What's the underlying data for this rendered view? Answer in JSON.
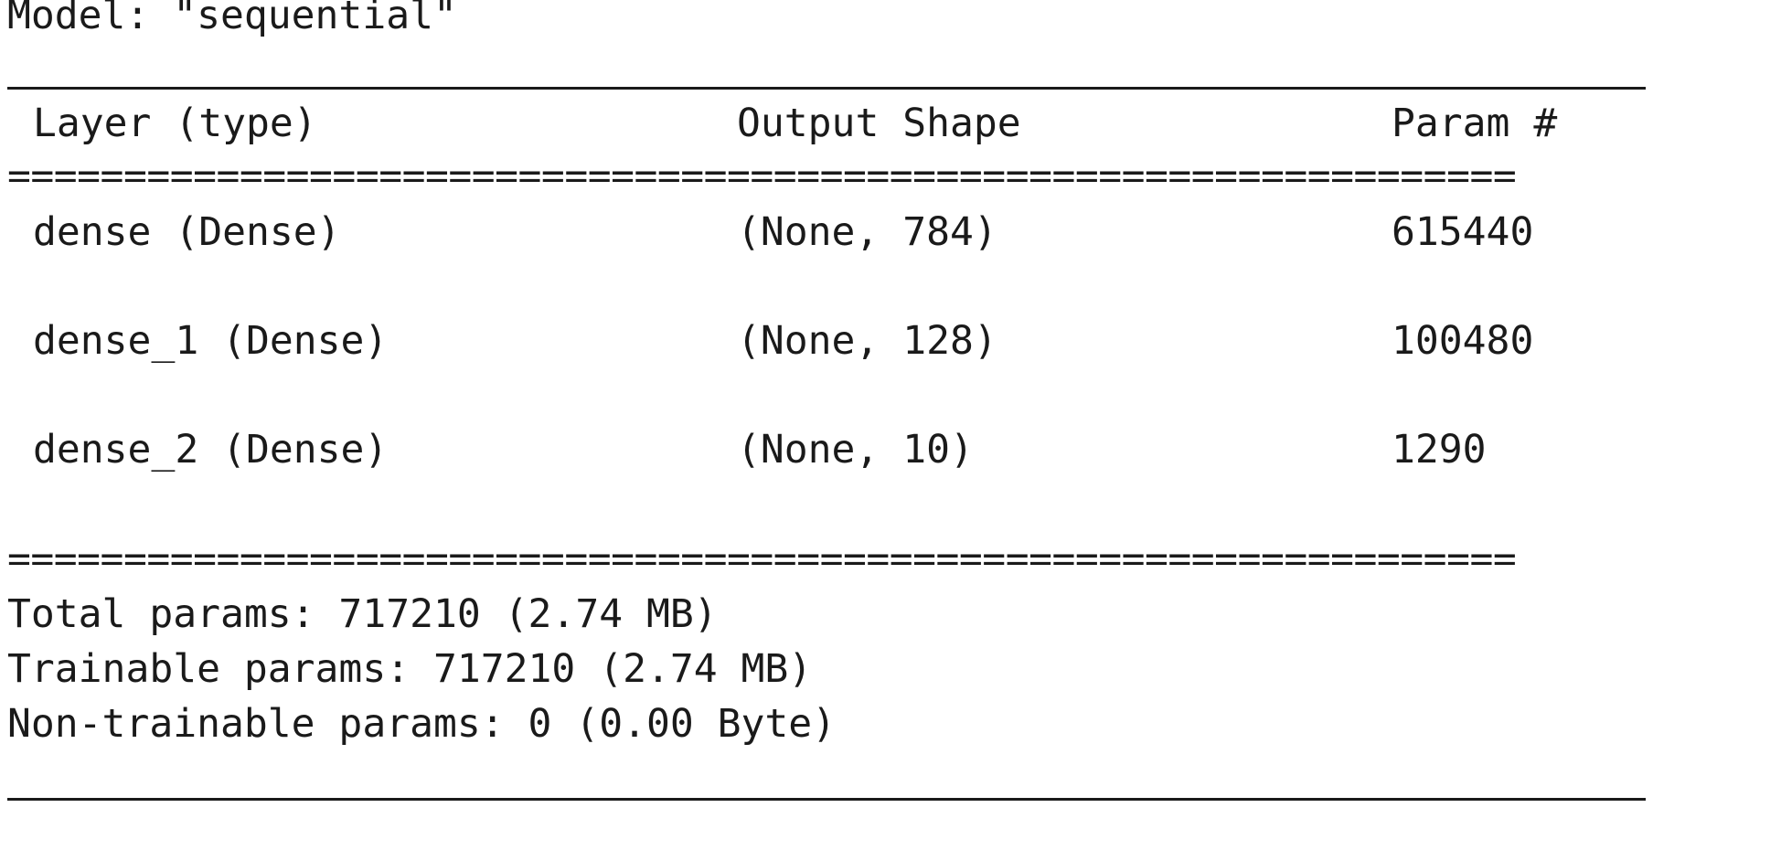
{
  "model_title": "Model: \"sequential\"",
  "table": {
    "headers": [
      "Layer (type)",
      "Output Shape",
      "Param #"
    ],
    "rows": [
      {
        "layer": "dense (Dense)",
        "shape": "(None, 784)",
        "params": "615440"
      },
      {
        "layer": "dense_1 (Dense)",
        "shape": "(None, 128)",
        "params": "100480"
      },
      {
        "layer": "dense_2 (Dense)",
        "shape": "(None, 10)",
        "params": "1290"
      }
    ]
  },
  "summary": {
    "total": "Total params: 717210 (2.74 MB)",
    "trainable": "Trainable params: 717210 (2.74 MB)",
    "non_trainable": "Non-trainable params: 0 (0.00 Byte)"
  },
  "double_rule_text": "================================================================="
}
